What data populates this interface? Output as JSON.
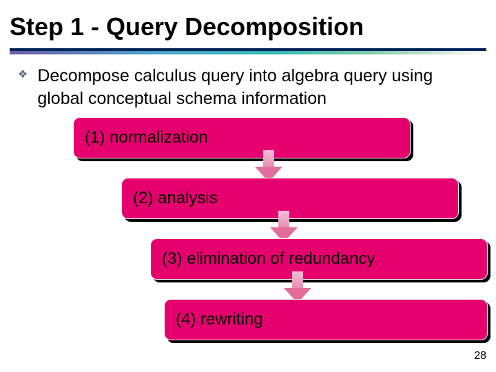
{
  "title": "Step 1 - Query Decomposition",
  "bullet": {
    "marker": "❖",
    "text": "Decompose calculus query into algebra query using global conceptual schema information"
  },
  "steps": [
    {
      "label": "(1) normalization"
    },
    {
      "label": "(2) analysis"
    },
    {
      "label": "(3) elimination of redundancy"
    },
    {
      "label": "(4) rewriting"
    }
  ],
  "page_number": "28"
}
